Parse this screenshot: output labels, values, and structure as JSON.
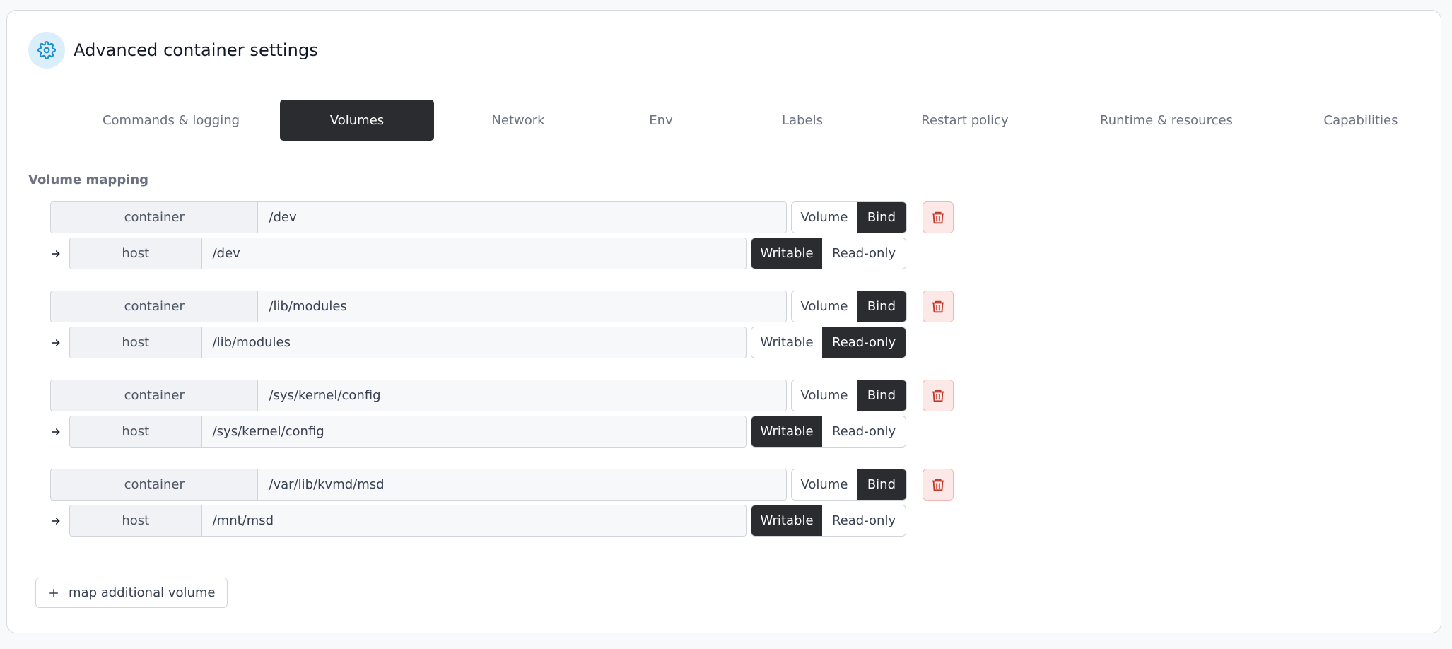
{
  "header": {
    "title": "Advanced container settings"
  },
  "tabs": [
    {
      "label": "Commands & logging",
      "active": false
    },
    {
      "label": "Volumes",
      "active": true
    },
    {
      "label": "Network",
      "active": false
    },
    {
      "label": "Env",
      "active": false
    },
    {
      "label": "Labels",
      "active": false
    },
    {
      "label": "Restart policy",
      "active": false
    },
    {
      "label": "Runtime & resources",
      "active": false
    },
    {
      "label": "Capabilities",
      "active": false
    }
  ],
  "section": {
    "label": "Volume mapping"
  },
  "volumes": [
    {
      "container_label": "container",
      "container_path": "/dev",
      "host_label": "host",
      "host_path": "/dev",
      "type_options": [
        "Volume",
        "Bind"
      ],
      "type_selected": "Bind",
      "mode_options": [
        "Writable",
        "Read-only"
      ],
      "mode_selected": "Writable"
    },
    {
      "container_label": "container",
      "container_path": "/lib/modules",
      "host_label": "host",
      "host_path": "/lib/modules",
      "type_options": [
        "Volume",
        "Bind"
      ],
      "type_selected": "Bind",
      "mode_options": [
        "Writable",
        "Read-only"
      ],
      "mode_selected": "Read-only"
    },
    {
      "container_label": "container",
      "container_path": "/sys/kernel/config",
      "host_label": "host",
      "host_path": "/sys/kernel/config",
      "type_options": [
        "Volume",
        "Bind"
      ],
      "type_selected": "Bind",
      "mode_options": [
        "Writable",
        "Read-only"
      ],
      "mode_selected": "Writable"
    },
    {
      "container_label": "container",
      "container_path": "/var/lib/kvmd/msd",
      "host_label": "host",
      "host_path": "/mnt/msd",
      "type_options": [
        "Volume",
        "Bind"
      ],
      "type_selected": "Bind",
      "mode_options": [
        "Writable",
        "Read-only"
      ],
      "mode_selected": "Writable"
    }
  ],
  "add_button": {
    "label": "map additional volume"
  },
  "colors": {
    "accent": "#2b2c2f",
    "icon_blue": "#1d8fd0",
    "danger": "#c0392b",
    "danger_bg": "#fde8e8"
  },
  "icons": {
    "header": "gear-icon",
    "arrow": "arrow-right-icon",
    "delete": "trash-icon",
    "add": "plus-icon"
  }
}
